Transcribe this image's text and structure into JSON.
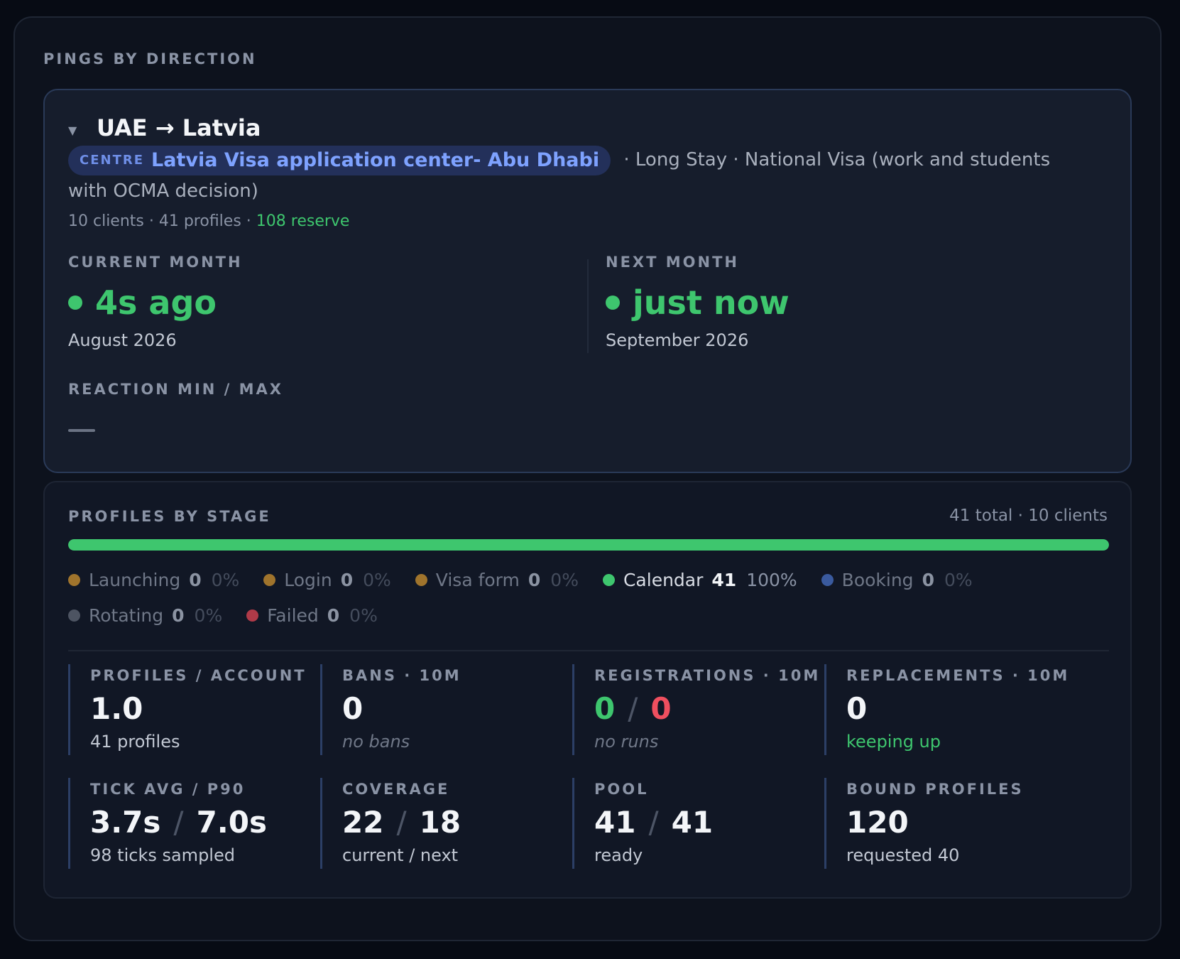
{
  "section_title": "PINGS BY DIRECTION",
  "direction": {
    "title": "UAE → Latvia",
    "centre_tag": "CENTRE",
    "centre_name": "Latvia Visa application center- Abu Dhabi",
    "desc_rest": " · Long Stay · National Visa (work and students with OCMA decision)",
    "stats_text": "10 clients · 41 profiles · ",
    "reserve": "108 reserve",
    "current_month": {
      "label": "CURRENT MONTH",
      "value": "4s ago",
      "sub": "August 2026"
    },
    "next_month": {
      "label": "NEXT MONTH",
      "value": "just now",
      "sub": "September 2026"
    },
    "reaction_label": "REACTION MIN / MAX"
  },
  "stages": {
    "title": "PROFILES BY STAGE",
    "total": "41 total · 10 clients",
    "progress_fraction": 1.0,
    "legend": [
      {
        "name": "Launching",
        "count": "0",
        "pct": "0%",
        "color": "#a0742c",
        "active": false
      },
      {
        "name": "Login",
        "count": "0",
        "pct": "0%",
        "color": "#a0742c",
        "active": false
      },
      {
        "name": "Visa form",
        "count": "0",
        "pct": "0%",
        "color": "#a0742c",
        "active": false
      },
      {
        "name": "Calendar",
        "count": "41",
        "pct": "100%",
        "color": "#3ec66e",
        "active": true
      },
      {
        "name": "Booking",
        "count": "0",
        "pct": "0%",
        "color": "#3a5a9e",
        "active": false
      },
      {
        "name": "Rotating",
        "count": "0",
        "pct": "0%",
        "color": "#4d5462",
        "active": false
      },
      {
        "name": "Failed",
        "count": "0",
        "pct": "0%",
        "color": "#b03a48",
        "active": false
      }
    ],
    "metrics": {
      "profiles_account": {
        "label": "PROFILES / ACCOUNT",
        "value": "1.0",
        "sub": "41 profiles"
      },
      "bans": {
        "label": "BANS · 10M",
        "value": "0",
        "sub": "no bans"
      },
      "registrations": {
        "label": "REGISTRATIONS · 10M",
        "value_a": "0",
        "value_b": "0",
        "sub": "no runs"
      },
      "replacements": {
        "label": "REPLACEMENTS · 10M",
        "value": "0",
        "sub": "keeping up"
      },
      "tick": {
        "label": "TICK AVG / P90",
        "value_a": "3.7s",
        "value_b": "7.0s",
        "sub": "98 ticks sampled"
      },
      "coverage": {
        "label": "COVERAGE",
        "value_a": "22",
        "value_b": "18",
        "sub": "current / next"
      },
      "pool": {
        "label": "POOL",
        "value_a": "41",
        "value_b": "41",
        "sub": "ready"
      },
      "bound": {
        "label": "BOUND PROFILES",
        "value": "120",
        "sub": "requested 40"
      }
    },
    "slash": "/"
  }
}
